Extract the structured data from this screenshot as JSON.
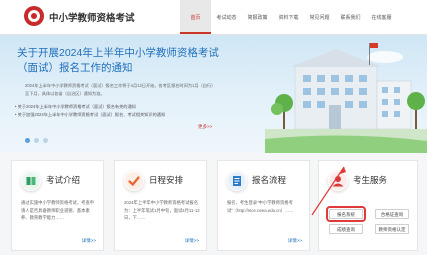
{
  "header": {
    "site_title": "中小学教师资格考试",
    "nav": [
      {
        "label": "首页",
        "active": true
      },
      {
        "label": "考试动态",
        "active": false
      },
      {
        "label": "简报政策",
        "active": false
      },
      {
        "label": "资料下载",
        "active": false
      },
      {
        "label": "常见问题",
        "active": false
      },
      {
        "label": "联系我们",
        "active": false
      },
      {
        "label": "在线客服",
        "active": false
      }
    ]
  },
  "banner": {
    "title": "关于开展2024年上半年中小学教师资格考试（面试）报名工作的通知",
    "desc": "2024年上半年中小学教师资格考试（面试）报名工作将于4月12日开始，各考区报名时间为1月（自行）至下月，具体以各省（自治区）通知为准。",
    "notes": [
      "关于2024年上半年中小学教师资格考试（面试）报名有关的通知",
      "关于加强2024年上半年中小学教师资格考试（面试）报名、考试相关知识的通知"
    ],
    "more": "更多>>",
    "dots": 3
  },
  "cards": [
    {
      "title": "考试介绍",
      "text": "通过实施中小学教师资格考试，考查申请人是否具备教师职业道德、基本素养、教育教学能力……",
      "more": "详情>>"
    },
    {
      "title": "日程安排",
      "text": "2024年上半年中小学教师资格考试报名为：上半年笔试1月中旬，面试4月11-12日，下……",
      "more": "详情>>"
    },
    {
      "title": "报名流程",
      "text": "报名、考生登录“中小学教师资格考试”（http://ntce.neea.edu.cn）……",
      "more": "详情>>"
    },
    {
      "title": "考生服务",
      "buttons": [
        "报名系统",
        "合格证查询",
        "成绩查询",
        "教师资格认定"
      ]
    }
  ],
  "colors": {
    "accent": "#c8352b",
    "link": "#1e6fba",
    "banner_bg": "#d9ecf8"
  }
}
